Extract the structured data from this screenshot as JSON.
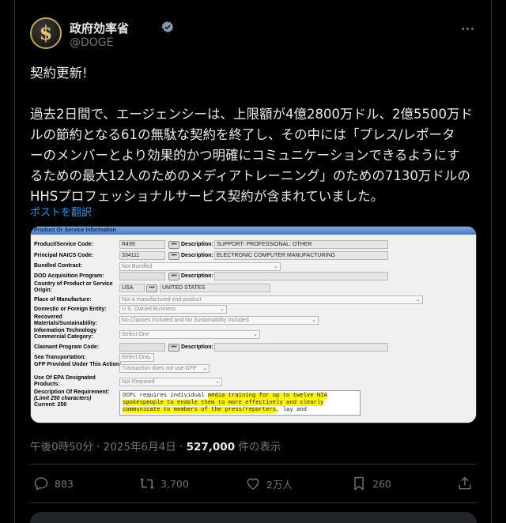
{
  "account": {
    "name": "政府効率省",
    "handle": "@DOGE",
    "avatar_symbol": "$"
  },
  "tweet": {
    "line1": "契約更新!",
    "body_lines": [
      "過去2日間で、エージェンシーは、上限額が4億2800万ドル、2億5500万ド",
      "ルの節約となる61の無駄な契約を終了し、その中には「プレス/レポータ",
      "ーのメンバーとより効果的かつ明確にコミュニケーションできるようにす",
      "るための最大12人のためのメディアトレーニング」のための7130万ドルの",
      "HHSプロフェッショナルサービス契約が含まれていました。"
    ],
    "translate_label": "ポストを翻訳"
  },
  "form": {
    "header": "Product Or Service Information",
    "rows": {
      "psc_label": "Product/Service Code:",
      "psc_value": "R499",
      "psc_desc_label": "Description:",
      "psc_desc": "SUPPORT- PROFESSIONAL: OTHER",
      "naics_label": "Principal NAICS Code:",
      "naics_value": "334111",
      "naics_desc_label": "Description:",
      "naics_desc": "ELECTRONIC COMPUTER MANUFACTURING",
      "bundled_label": "Bundled Contract:",
      "bundled_value": "Not Bundled",
      "dod_label": "DOD Acquisition Program:",
      "dod_desc_label": "Description:",
      "country_label": "Country of Product or Service Origin:",
      "country_code": "USA",
      "country_name": "UNITED STATES",
      "place_label": "Place of Manufacture:",
      "place_value": "Not a manufactured end product",
      "domestic_label": "Domestic or Foreign Entity:",
      "domestic_value": "U.S. Owned Business",
      "recovered_label": "Recovered Materials/Sustainability:",
      "recovered_value": "No Clauses Included and No Sustainability Included",
      "it_label": "Information Technology Commercial Category:",
      "it_value": "Select One",
      "claimant_label": "Claimant Program Code:",
      "claimant_desc_label": "Description:",
      "sea_label": "Sea Transportation:",
      "sea_value": "Select One",
      "gfp_label": "GFP Provided Under This Action:",
      "gfp_value": "Transaction does not use GFP",
      "epa_label": "Use Of EPA Designated Products:",
      "epa_value": "Not Required",
      "desc_label": "Description Of Requirement:",
      "desc_limit": "(Limit 250 characters)",
      "desc_current": "Current: 250",
      "desc_pre": "OCPL requires individual ",
      "desc_hl1": "media training for up to twelve NIA",
      "desc_hl2": "spokespeople to enable them to more effectively and clearly",
      "desc_hl3": "communicate to members of the press/reporters",
      "desc_post": ", lay and"
    }
  },
  "meta": {
    "time": "午後0時50分",
    "sep1": "·",
    "date": "2025年6月4日",
    "sep2": "·",
    "views": "527,000",
    "views_suffix": "件の表示"
  },
  "actions": {
    "replies": "883",
    "reposts": "3,700",
    "likes": "2万人",
    "bookmarks": "260"
  },
  "colors": {
    "link": "#1d9bf0",
    "muted": "#71767b",
    "highlight": "#fff200"
  }
}
